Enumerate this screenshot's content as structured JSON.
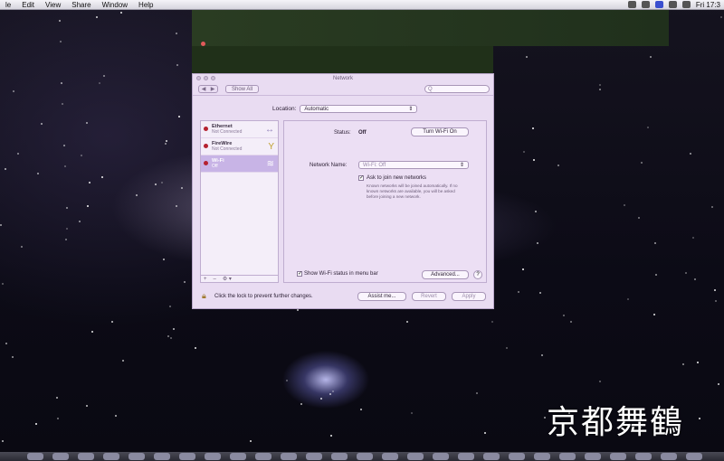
{
  "menubar": {
    "items": [
      "le",
      "Edit",
      "View",
      "Share",
      "Window",
      "Help"
    ],
    "clock": "Fri 17:3"
  },
  "window": {
    "title": "Network",
    "show_all": "Show All",
    "nav_back": "◀",
    "nav_fwd": "▶",
    "search_placeholder": "Q",
    "location_label": "Location:",
    "location_value": "Automatic",
    "services": [
      {
        "name": "Ethernet",
        "status": "Not Connected",
        "icon": "↔"
      },
      {
        "name": "FireWire",
        "status": "Not Connected",
        "icon": "Y"
      },
      {
        "name": "Wi-Fi",
        "status": "Off",
        "icon": "≋"
      }
    ],
    "sidebar_controls": [
      "+",
      "–",
      "⚙ ▾"
    ],
    "status_label": "Status:",
    "status_value": "Off",
    "turn_wifi_on": "Turn Wi-Fi On",
    "network_name_label": "Network Name:",
    "network_name_value": "Wi-Fi: Off",
    "ask_join_label": "Ask to join new networks",
    "ask_join_help": "Known networks will be joined automatically. If no known networks are available, you will be asked before joining a new network.",
    "show_wifi_status": "Show Wi-Fi status in menu bar",
    "advanced": "Advanced...",
    "help": "?",
    "lock_text": "Click the lock to prevent further changes.",
    "assist_me": "Assist me...",
    "revert": "Revert",
    "apply": "Apply"
  },
  "watermark": "京都舞鶴"
}
